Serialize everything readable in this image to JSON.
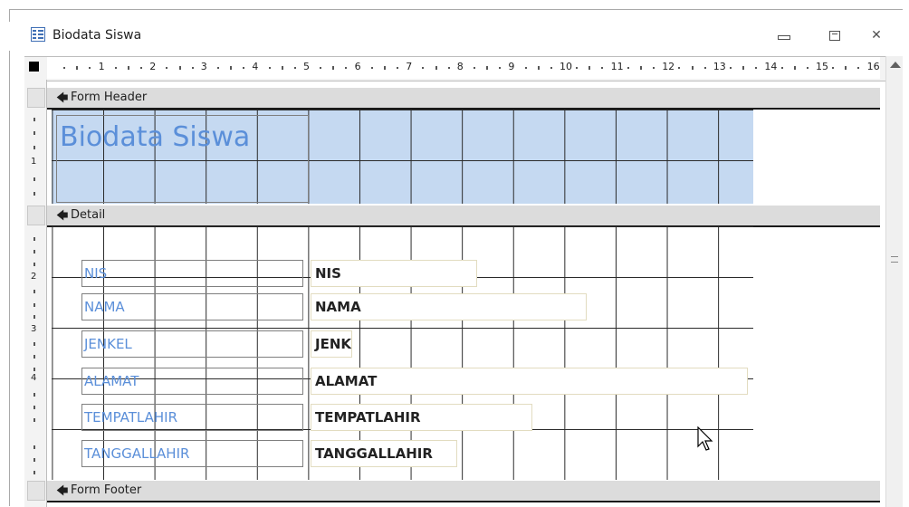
{
  "window": {
    "title": "Biodata Siswa",
    "minimize_glyph": "▭",
    "restore_glyph": "⧉",
    "close_glyph": "✕"
  },
  "ruler": {
    "numbers": [
      "1",
      "2",
      "3",
      "4",
      "5",
      "6",
      "7",
      "8",
      "9",
      "10",
      "11",
      "12",
      "13",
      "14",
      "15",
      "16"
    ],
    "vertical_numbers": [
      "1",
      "2",
      "3",
      "4"
    ]
  },
  "sections": {
    "header": "Form Header",
    "detail": "Detail",
    "footer": "Form Footer"
  },
  "form_header": {
    "title_label": "Biodata Siswa"
  },
  "fields": [
    {
      "label": "NIS",
      "control": "NIS"
    },
    {
      "label": "NAMA",
      "control": "NAMA"
    },
    {
      "label": "JENKEL",
      "control": "JENK"
    },
    {
      "label": "ALAMAT",
      "control": "ALAMAT"
    },
    {
      "label": "TEMPATLAHIR",
      "control": "TEMPATLAHIR"
    },
    {
      "label": "TANGGALLAHIR",
      "control": "TANGGALLAHIR"
    }
  ],
  "colors": {
    "header_fill": "#c5d9f1",
    "label_text": "#5b8fd9",
    "grid_line": "#2a2a2a"
  }
}
